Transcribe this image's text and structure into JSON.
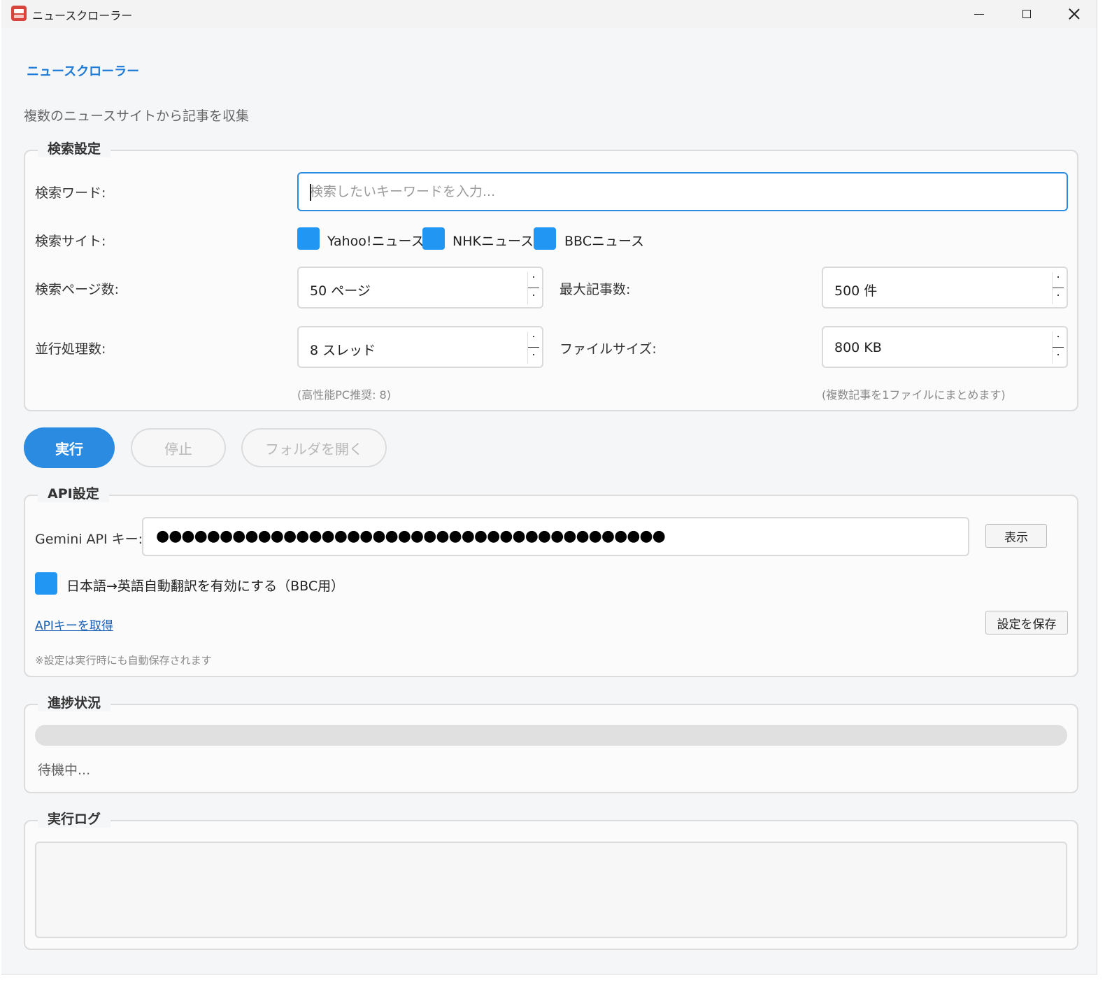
{
  "window": {
    "title": "ニュースクローラー",
    "accent_color": "#2a8be0"
  },
  "header": {
    "heading": "ニュースクローラー",
    "subtitle": "複数のニュースサイトから記事を収集"
  },
  "search": {
    "legend": "検索設定",
    "keyword_label": "検索ワード:",
    "keyword_value": "",
    "keyword_placeholder": "検索したいキーワードを入力...",
    "sites_label": "検索サイト:",
    "sites": [
      {
        "label": "Yahoo!ニュース",
        "checked": true
      },
      {
        "label": "NHKニュース",
        "checked": true
      },
      {
        "label": "BBCニュース",
        "checked": true
      }
    ],
    "pages_label": "検索ページ数:",
    "pages_value": "50 ページ",
    "max_articles_label": "最大記事数:",
    "max_articles_value": "500 件",
    "threads_label": "並行処理数:",
    "threads_value": "8 スレッド",
    "file_size_label": "ファイルサイズ:",
    "file_size_value": "800 KB",
    "threads_hint": "(高性能PC推奨: 8)",
    "file_size_hint": "(複数記事を1ファイルにまとめます)"
  },
  "actions": {
    "run": "実行",
    "stop": "停止",
    "open_folder": "フォルダを開く"
  },
  "api": {
    "legend": "API設定",
    "key_label": "Gemini API キー:",
    "key_masked": "●●●●●●●●●●●●●●●●●●●●●●●●●●●●●●●●●●●●●●●●",
    "show_button": "表示",
    "translate_label": "日本語→英語自動翻訳を有効にする（BBC用）",
    "translate_checked": true,
    "get_key_link": "APIキーを取得",
    "save_button": "設定を保存",
    "note": "※設定は実行時にも自動保存されます"
  },
  "progress": {
    "legend": "進捗状況",
    "value": 0,
    "status": "待機中..."
  },
  "log": {
    "legend": "実行ログ",
    "content": ""
  }
}
